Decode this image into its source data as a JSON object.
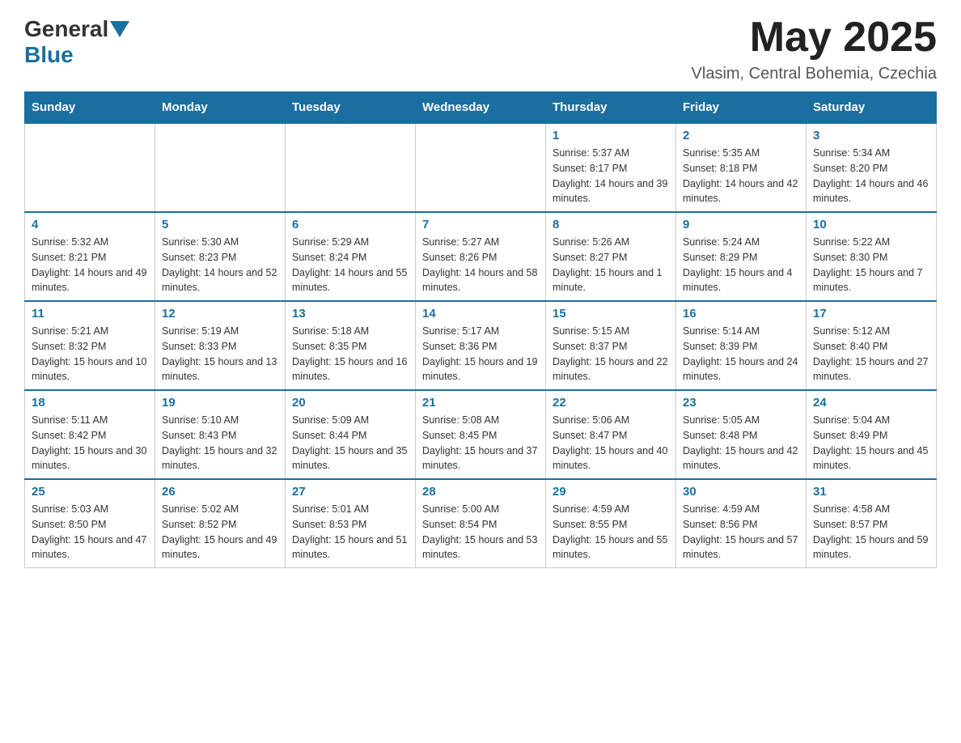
{
  "header": {
    "logo_general": "General",
    "logo_blue": "Blue",
    "month_year": "May 2025",
    "location": "Vlasim, Central Bohemia, Czechia"
  },
  "days_of_week": [
    "Sunday",
    "Monday",
    "Tuesday",
    "Wednesday",
    "Thursday",
    "Friday",
    "Saturday"
  ],
  "weeks": [
    [
      {
        "day": "",
        "info": ""
      },
      {
        "day": "",
        "info": ""
      },
      {
        "day": "",
        "info": ""
      },
      {
        "day": "",
        "info": ""
      },
      {
        "day": "1",
        "info": "Sunrise: 5:37 AM\nSunset: 8:17 PM\nDaylight: 14 hours and 39 minutes."
      },
      {
        "day": "2",
        "info": "Sunrise: 5:35 AM\nSunset: 8:18 PM\nDaylight: 14 hours and 42 minutes."
      },
      {
        "day": "3",
        "info": "Sunrise: 5:34 AM\nSunset: 8:20 PM\nDaylight: 14 hours and 46 minutes."
      }
    ],
    [
      {
        "day": "4",
        "info": "Sunrise: 5:32 AM\nSunset: 8:21 PM\nDaylight: 14 hours and 49 minutes."
      },
      {
        "day": "5",
        "info": "Sunrise: 5:30 AM\nSunset: 8:23 PM\nDaylight: 14 hours and 52 minutes."
      },
      {
        "day": "6",
        "info": "Sunrise: 5:29 AM\nSunset: 8:24 PM\nDaylight: 14 hours and 55 minutes."
      },
      {
        "day": "7",
        "info": "Sunrise: 5:27 AM\nSunset: 8:26 PM\nDaylight: 14 hours and 58 minutes."
      },
      {
        "day": "8",
        "info": "Sunrise: 5:26 AM\nSunset: 8:27 PM\nDaylight: 15 hours and 1 minute."
      },
      {
        "day": "9",
        "info": "Sunrise: 5:24 AM\nSunset: 8:29 PM\nDaylight: 15 hours and 4 minutes."
      },
      {
        "day": "10",
        "info": "Sunrise: 5:22 AM\nSunset: 8:30 PM\nDaylight: 15 hours and 7 minutes."
      }
    ],
    [
      {
        "day": "11",
        "info": "Sunrise: 5:21 AM\nSunset: 8:32 PM\nDaylight: 15 hours and 10 minutes."
      },
      {
        "day": "12",
        "info": "Sunrise: 5:19 AM\nSunset: 8:33 PM\nDaylight: 15 hours and 13 minutes."
      },
      {
        "day": "13",
        "info": "Sunrise: 5:18 AM\nSunset: 8:35 PM\nDaylight: 15 hours and 16 minutes."
      },
      {
        "day": "14",
        "info": "Sunrise: 5:17 AM\nSunset: 8:36 PM\nDaylight: 15 hours and 19 minutes."
      },
      {
        "day": "15",
        "info": "Sunrise: 5:15 AM\nSunset: 8:37 PM\nDaylight: 15 hours and 22 minutes."
      },
      {
        "day": "16",
        "info": "Sunrise: 5:14 AM\nSunset: 8:39 PM\nDaylight: 15 hours and 24 minutes."
      },
      {
        "day": "17",
        "info": "Sunrise: 5:12 AM\nSunset: 8:40 PM\nDaylight: 15 hours and 27 minutes."
      }
    ],
    [
      {
        "day": "18",
        "info": "Sunrise: 5:11 AM\nSunset: 8:42 PM\nDaylight: 15 hours and 30 minutes."
      },
      {
        "day": "19",
        "info": "Sunrise: 5:10 AM\nSunset: 8:43 PM\nDaylight: 15 hours and 32 minutes."
      },
      {
        "day": "20",
        "info": "Sunrise: 5:09 AM\nSunset: 8:44 PM\nDaylight: 15 hours and 35 minutes."
      },
      {
        "day": "21",
        "info": "Sunrise: 5:08 AM\nSunset: 8:45 PM\nDaylight: 15 hours and 37 minutes."
      },
      {
        "day": "22",
        "info": "Sunrise: 5:06 AM\nSunset: 8:47 PM\nDaylight: 15 hours and 40 minutes."
      },
      {
        "day": "23",
        "info": "Sunrise: 5:05 AM\nSunset: 8:48 PM\nDaylight: 15 hours and 42 minutes."
      },
      {
        "day": "24",
        "info": "Sunrise: 5:04 AM\nSunset: 8:49 PM\nDaylight: 15 hours and 45 minutes."
      }
    ],
    [
      {
        "day": "25",
        "info": "Sunrise: 5:03 AM\nSunset: 8:50 PM\nDaylight: 15 hours and 47 minutes."
      },
      {
        "day": "26",
        "info": "Sunrise: 5:02 AM\nSunset: 8:52 PM\nDaylight: 15 hours and 49 minutes."
      },
      {
        "day": "27",
        "info": "Sunrise: 5:01 AM\nSunset: 8:53 PM\nDaylight: 15 hours and 51 minutes."
      },
      {
        "day": "28",
        "info": "Sunrise: 5:00 AM\nSunset: 8:54 PM\nDaylight: 15 hours and 53 minutes."
      },
      {
        "day": "29",
        "info": "Sunrise: 4:59 AM\nSunset: 8:55 PM\nDaylight: 15 hours and 55 minutes."
      },
      {
        "day": "30",
        "info": "Sunrise: 4:59 AM\nSunset: 8:56 PM\nDaylight: 15 hours and 57 minutes."
      },
      {
        "day": "31",
        "info": "Sunrise: 4:58 AM\nSunset: 8:57 PM\nDaylight: 15 hours and 59 minutes."
      }
    ]
  ]
}
